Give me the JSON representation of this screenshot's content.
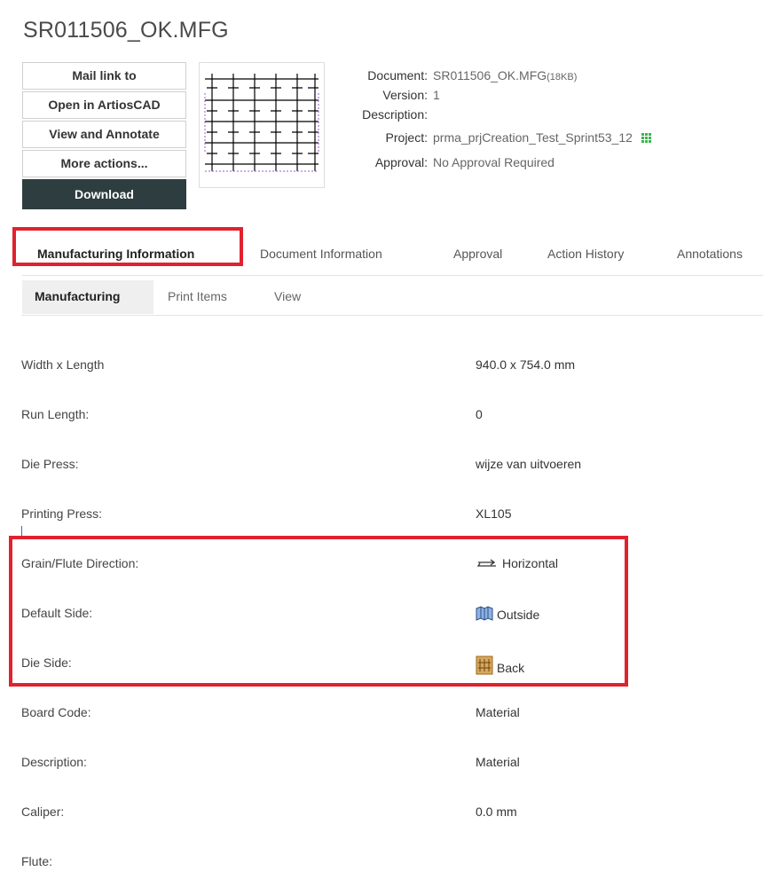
{
  "title": "SR011506_OK.MFG",
  "actions": {
    "mail_link": "Mail link to",
    "open_in": "Open in ArtiosCAD",
    "view_annotate": "View and Annotate",
    "more": "More actions...",
    "download": "Download"
  },
  "meta": {
    "document_label": "Document:",
    "document_value": "SR011506_OK.MFG",
    "document_size": "(18KB)",
    "version_label": "Version:",
    "version_value": "1",
    "description_label": "Description:",
    "description_value": "",
    "project_label": "Project:",
    "project_value": "prma_prjCreation_Test_Sprint53_12",
    "approval_label": "Approval:",
    "approval_value": "No Approval Required"
  },
  "tabs": [
    "Manufacturing Information",
    "Document Information",
    "Approval",
    "Action History",
    "Annotations"
  ],
  "subtabs": [
    "Manufacturing",
    "Print Items",
    "View"
  ],
  "rows": [
    {
      "label": "Width x Length",
      "value": "940.0 x 754.0  mm"
    },
    {
      "label": "Run Length:",
      "value": "0"
    },
    {
      "label": "Die Press:",
      "value": "wijze van uitvoeren"
    },
    {
      "label": "Printing Press:",
      "value": "XL105"
    },
    {
      "label": "Grain/Flute Direction:",
      "value": "Horizontal",
      "icon": "horizontal-arrows-icon"
    },
    {
      "label": "Default Side:",
      "value": "Outside",
      "icon": "box-outside-icon"
    },
    {
      "label": "Die Side:",
      "value": "Back",
      "icon": "die-back-icon"
    },
    {
      "label": "Board Code:",
      "value": "Material"
    },
    {
      "label": "Description:",
      "value": "Material"
    },
    {
      "label": "Caliper:",
      "value": "0.0  mm"
    },
    {
      "label": "Flute:",
      "value": ""
    }
  ],
  "colors": {
    "highlight": "#e0222e",
    "download_bg": "#2e3d3f",
    "project_icon": "#3ab54a"
  }
}
